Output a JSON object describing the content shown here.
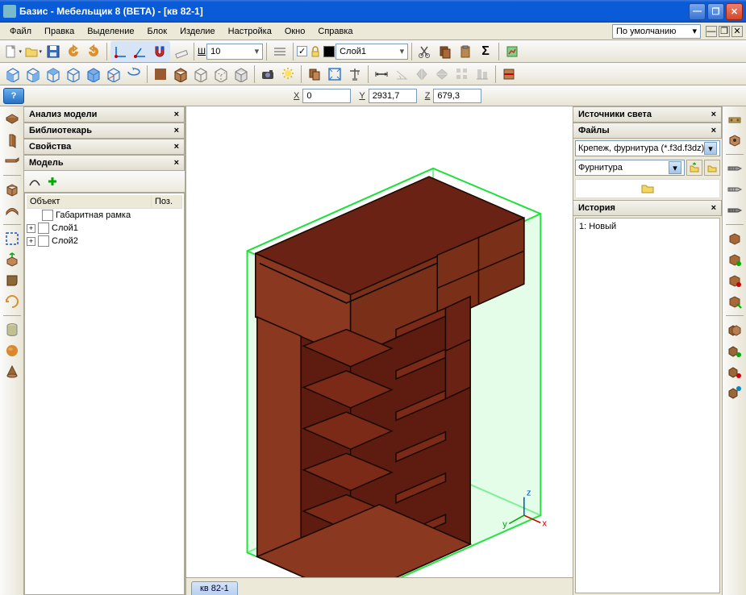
{
  "title": "Базис - Мебельщик 8 (BETA) - [кв 82-1]",
  "menu": {
    "items": [
      "Файл",
      "Правка",
      "Выделение",
      "Блок",
      "Изделие",
      "Настройка",
      "Окно",
      "Справка"
    ],
    "scheme_label": "По умолчанию"
  },
  "toolbar1": {
    "width_label": "Ш",
    "width_value": "10",
    "layer_label": "Слой1"
  },
  "coords": {
    "x_label": "X",
    "x_value": "0",
    "y_label": "Y",
    "y_value": "2931,7",
    "z_label": "Z",
    "z_value": "679,3"
  },
  "left_panels": {
    "analysis": "Анализ модели",
    "librarian": "Библиотекарь",
    "properties": "Свойства",
    "model": "Модель"
  },
  "tree": {
    "col_object": "Объект",
    "col_pos": "Поз.",
    "items": [
      {
        "label": "Габаритная рамка",
        "expand": "",
        "indent": 0
      },
      {
        "label": "Слой1",
        "expand": "+",
        "indent": 0
      },
      {
        "label": "Слой2",
        "expand": "+",
        "indent": 0
      }
    ]
  },
  "right_panels": {
    "lights": "Источники света",
    "files": "Файлы",
    "filter": "Крепеж, фурнитура (*.f3d.f3dz)",
    "furniture": "Фурнитура",
    "history": "История",
    "history_item": "1: Новый"
  },
  "viewport_tab": "кв 82-1"
}
